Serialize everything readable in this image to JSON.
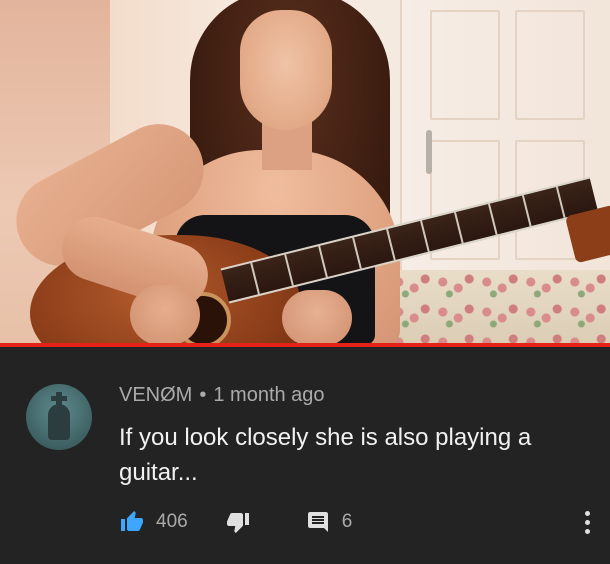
{
  "video": {
    "progress_fraction": 1.0,
    "accent_color": "#e62117"
  },
  "comment": {
    "author": "VENØM",
    "separator": "•",
    "timestamp": "1 month ago",
    "text": "If you look closely she is also playing a guitar...",
    "likes": "406",
    "replies": "6",
    "icons": {
      "like": "thumbs-up-icon",
      "dislike": "thumbs-down-icon",
      "reply": "comment-icon",
      "more": "more-vert-icon"
    },
    "colors": {
      "like_active": "#3ea6ff",
      "text": "#f1f1f1",
      "meta": "#aaaaaa",
      "background": "#232323"
    }
  }
}
